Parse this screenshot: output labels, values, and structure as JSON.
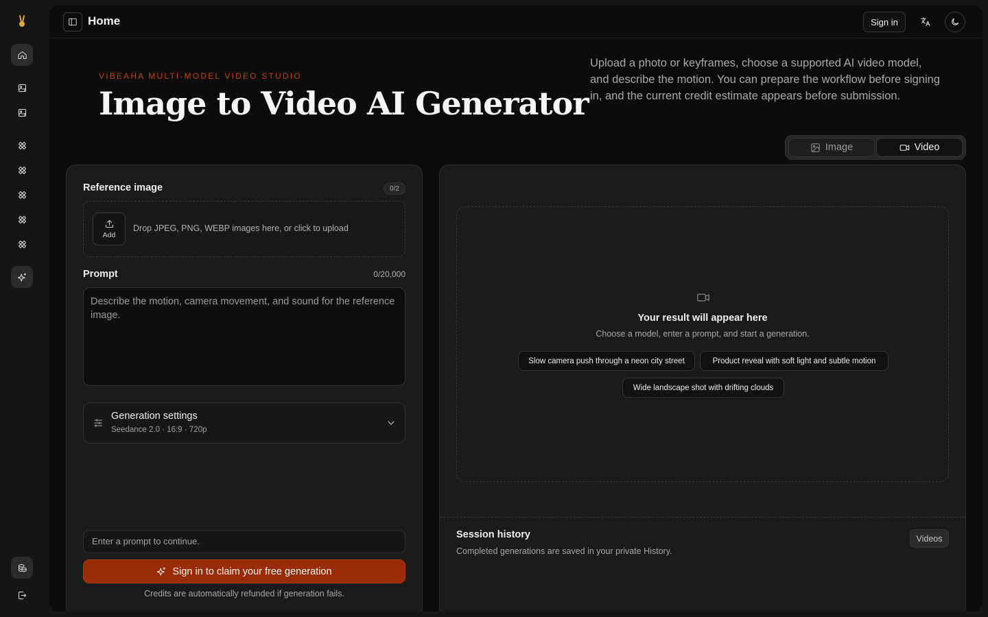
{
  "header": {
    "title": "Home",
    "sign_in_label": "Sign in",
    "language_icon": "translate-icon",
    "theme_icon": "moon-icon"
  },
  "rail": {
    "items": [
      {
        "icon": "home-icon",
        "active": true
      },
      {
        "icon": "image-ai-icon",
        "active": false
      },
      {
        "icon": "image-ai-icon",
        "active": false
      },
      {
        "icon": "tools-icon",
        "active": false
      },
      {
        "icon": "tools-icon",
        "active": false
      },
      {
        "icon": "tools-icon",
        "active": false
      },
      {
        "icon": "tools-icon",
        "active": false
      },
      {
        "icon": "tools-icon",
        "active": false
      },
      {
        "icon": "sparkles-icon",
        "active": true
      }
    ],
    "bottom": [
      {
        "icon": "coins-icon"
      },
      {
        "icon": "sign-out-icon"
      }
    ]
  },
  "hero": {
    "eyebrow": "VIBEAHA MULTI-MODEL VIDEO STUDIO",
    "title": "Image to Video AI Generator",
    "description": "Upload a photo or keyframes, choose a supported AI video model, and describe the motion. You can prepare the workflow before signing in, and the current credit estimate appears before submission."
  },
  "mode_toggle": {
    "options": [
      {
        "label": "Image",
        "icon": "image-icon",
        "selected": false
      },
      {
        "label": "Video",
        "icon": "video-icon",
        "selected": true
      }
    ]
  },
  "form": {
    "reference_label": "Reference image",
    "reference_count": "0/2",
    "upload_button_label": "Add",
    "upload_text": "Drop JPEG, PNG, WEBP images here, or click to upload",
    "prompt_label": "Prompt",
    "prompt_count": "0/20,000",
    "prompt_placeholder": "Describe the motion, camera movement, and sound for the reference image.",
    "settings_title": "Generation settings",
    "settings_summary": "Seedance 2.0 · 16:9 · 720p",
    "hint": "Enter a prompt to continue.",
    "cta_label": "Sign in to claim your free generation",
    "refund_note": "Credits are automatically refunded if generation fails."
  },
  "result": {
    "title": "Your result will appear here",
    "subtitle": "Choose a model, enter a prompt, and start a generation.",
    "suggestions": [
      "Slow camera push through a neon city street",
      "Product reveal with soft light and subtle motion",
      "Wide landscape shot with drifting clouds"
    ]
  },
  "history": {
    "title": "Session history",
    "subtitle": "Completed generations are saved in your private History.",
    "badge": "Videos"
  },
  "colors": {
    "accent": "#c2410c",
    "cta": "#9a2c05",
    "background": "#0c0c0c",
    "panel": "#1a1a1a"
  }
}
